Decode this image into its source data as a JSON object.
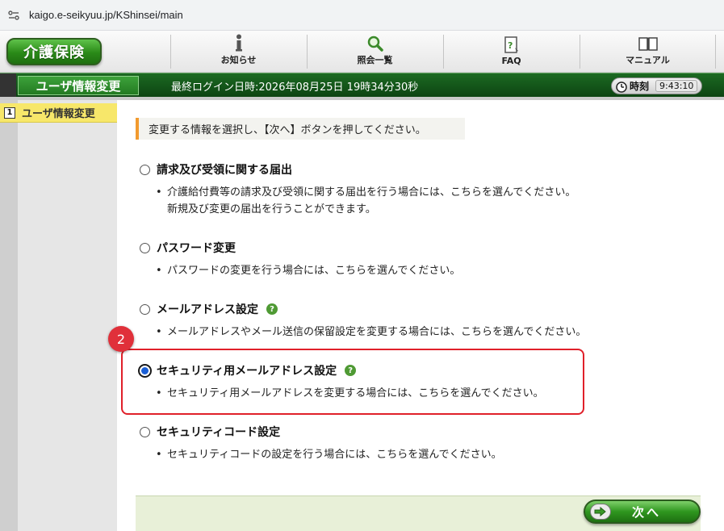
{
  "browser": {
    "url": "kaigo.e-seikyuu.jp/KShinsei/main"
  },
  "header": {
    "logo_label": "介護保険",
    "nav": [
      {
        "label": "お知らせ",
        "icon": "info-icon"
      },
      {
        "label": "照会一覧",
        "icon": "magnifier-icon"
      },
      {
        "label": "FAQ",
        "icon": "faq-icon"
      },
      {
        "label": "マニュアル",
        "icon": "book-icon"
      }
    ]
  },
  "titlebar": {
    "page_title": "ユーザ情報変更",
    "last_login": "最終ログイン日時:2026年08月25日 19時34分30秒",
    "clock_label": "時刻",
    "clock_time": "9:43:10"
  },
  "sidebar": {
    "items": [
      {
        "num": "1",
        "label": "ユーザ情報変更"
      }
    ]
  },
  "main": {
    "instruction": "変更する情報を選択し、【次へ】ボタンを押してください。",
    "options": [
      {
        "title": "請求及び受領に関する届出",
        "desc1": "介護給付費等の請求及び受領に関する届出を行う場合には、こちらを選んでください。",
        "desc2": "新規及び変更の届出を行うことができます。",
        "help": false,
        "checked": false
      },
      {
        "title": "パスワード変更",
        "desc1": "パスワードの変更を行う場合には、こちらを選んでください。",
        "help": false,
        "checked": false
      },
      {
        "title": "メールアドレス設定",
        "desc1": "メールアドレスやメール送信の保留設定を変更する場合には、こちらを選んでください。",
        "help": true,
        "checked": false
      },
      {
        "title": "セキュリティ用メールアドレス設定",
        "desc1": "セキュリティ用メールアドレスを変更する場合には、こちらを選んでください。",
        "help": true,
        "checked": true
      },
      {
        "title": "セキュリティコード設定",
        "desc1": "セキュリティコードの設定を行う場合には、こちらを選んでください。",
        "help": false,
        "checked": false
      }
    ],
    "help_symbol": "?",
    "bullet": "•"
  },
  "annotation": {
    "step_number": "2"
  },
  "footer": {
    "next_label": "次へ"
  },
  "colors": {
    "brand_green": "#2a8a18",
    "title_bar": "#0d4412",
    "highlight_red": "#e0202a",
    "radio_blue": "#1a5fd6"
  }
}
